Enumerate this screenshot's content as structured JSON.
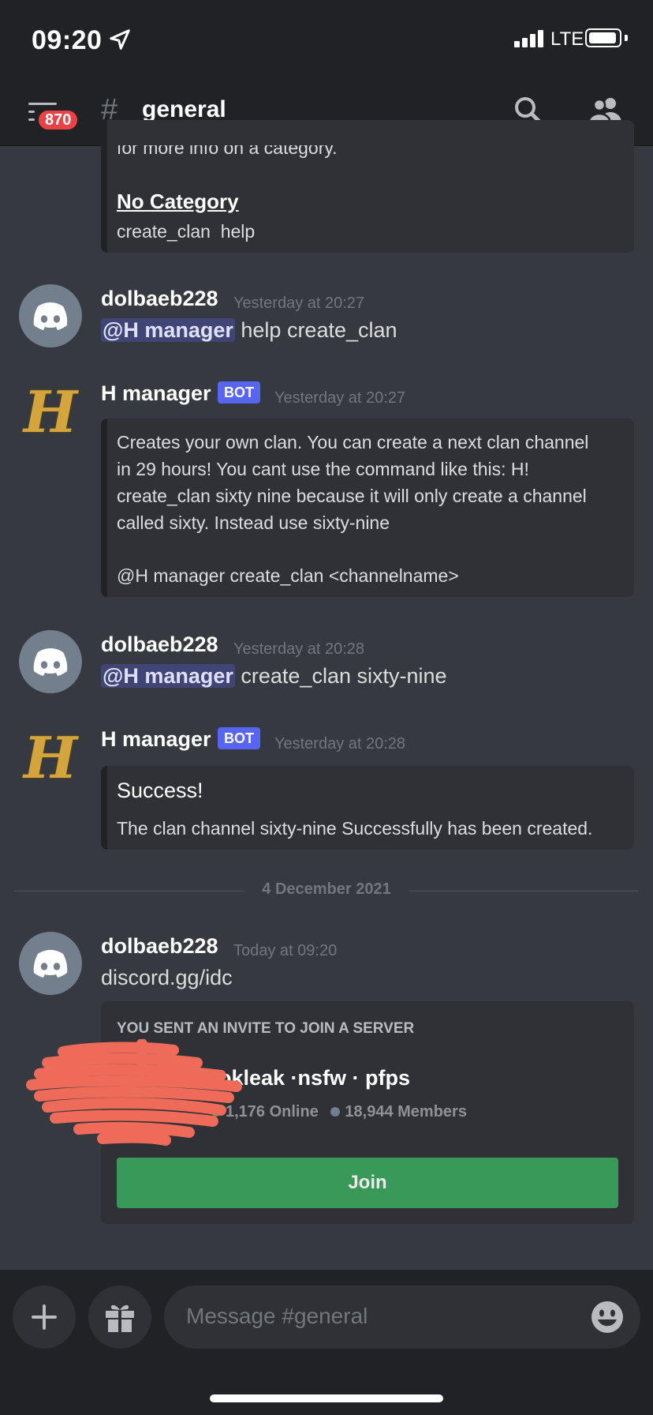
{
  "status_bar": {
    "time": "09:20",
    "carrier": "LTE"
  },
  "header": {
    "unread_badge": "870",
    "channel_name": "general",
    "hash_symbol": "#"
  },
  "top_embed": {
    "cut_text": "for more info on a category.",
    "category_title": "No Category",
    "commands": "create_clan  help"
  },
  "messages": [
    {
      "author": "dolbaeb228",
      "timestamp": "Yesterday at 20:27",
      "mention": "@H manager",
      "text": " help create_clan"
    },
    {
      "author": "H manager",
      "bot_tag": "BOT",
      "timestamp": "Yesterday at 20:27",
      "embed_lines": [
        "Creates your own clan. You can create a next clan channel",
        "in 29 hours! You cant use the command like this: H!",
        "create_clan sixty nine because it will only create a channel",
        "called sixty. Instead use sixty-nine"
      ],
      "embed_usage": "@H manager create_clan <channelname>"
    },
    {
      "author": "dolbaeb228",
      "timestamp": "Yesterday at 20:28",
      "mention": "@H manager",
      "text": " create_clan sixty-nine"
    },
    {
      "author": "H manager",
      "bot_tag": "BOT",
      "timestamp": "Yesterday at 20:28",
      "embed_title": "Success!",
      "embed_desc": "The clan channel sixty-nine Successfully has been created."
    },
    {
      "author": "dolbaeb228",
      "timestamp": "Today at 09:20",
      "text": "discord.gg/idc"
    }
  ],
  "date_divider": "4 December 2021",
  "invite": {
    "heading": "YOU SENT AN INVITE TO JOIN A SERVER",
    "server_name": "tokleak ·nsfw · pfps",
    "online": "1,176 Online",
    "members": "18,944 Members",
    "join_label": "Join",
    "online_color": "#3ba55d",
    "member_color": "#747f8d"
  },
  "composer": {
    "placeholder": "Message #general"
  },
  "colors": {
    "background": "#36393f",
    "header": "#202225",
    "embed": "#2f3136",
    "accent": "#5865f2",
    "join": "#3ba55d",
    "badge": "#ed4245",
    "redaction": "#ee6b5a"
  }
}
